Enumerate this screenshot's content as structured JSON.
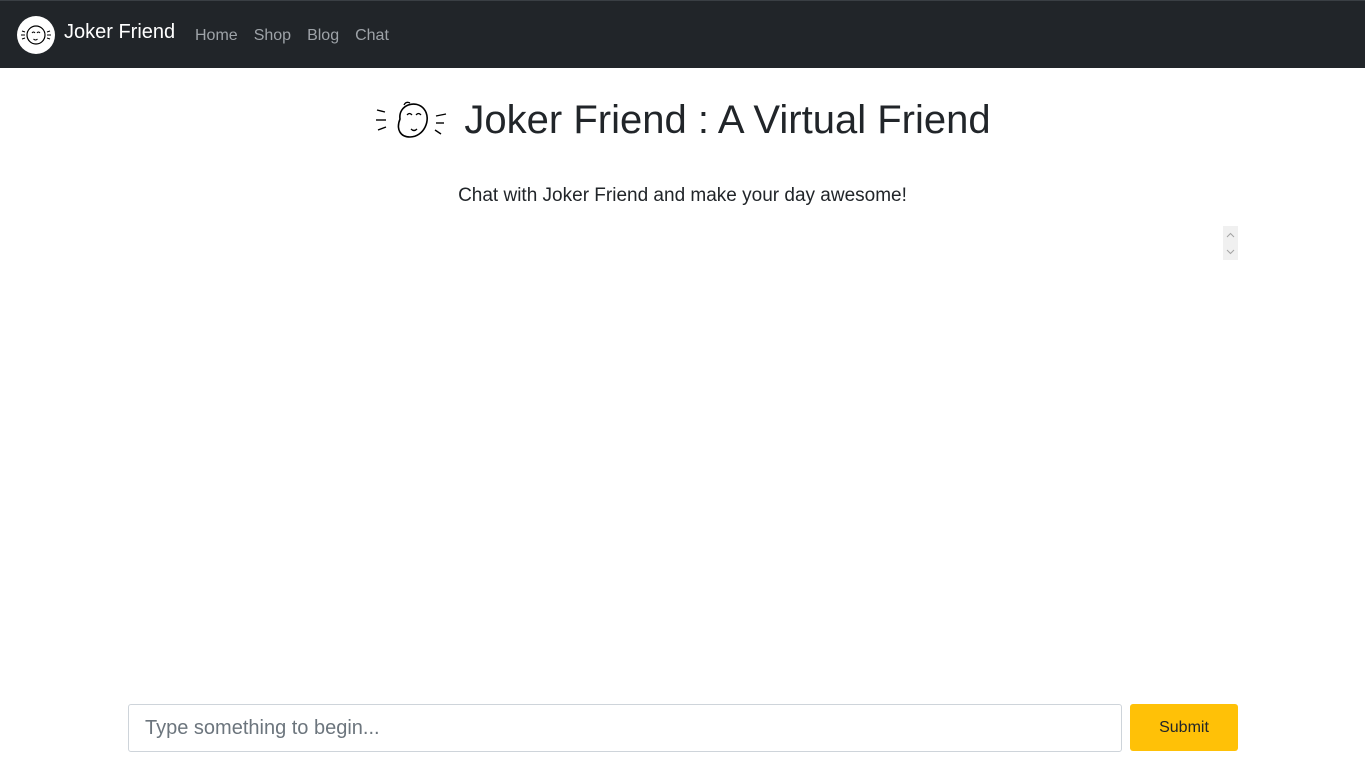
{
  "navbar": {
    "brand_name": "Joker Friend",
    "links": [
      {
        "label": "Home"
      },
      {
        "label": "Shop"
      },
      {
        "label": "Blog"
      },
      {
        "label": "Chat"
      }
    ],
    "background": "#212529"
  },
  "header": {
    "title": "Joker Friend : A Virtual Friend",
    "subtitle": "Chat with Joker Friend and make your day awesome!"
  },
  "chat": {
    "input_placeholder": "Type something to begin...",
    "input_value": "",
    "submit_label": "Submit",
    "submit_color": "#ffc107"
  },
  "icons": {
    "brand": "joker-face-icon",
    "heading": "joker-face-icon",
    "scroll_up": "chevron-up-icon",
    "scroll_down": "chevron-down-icon"
  }
}
